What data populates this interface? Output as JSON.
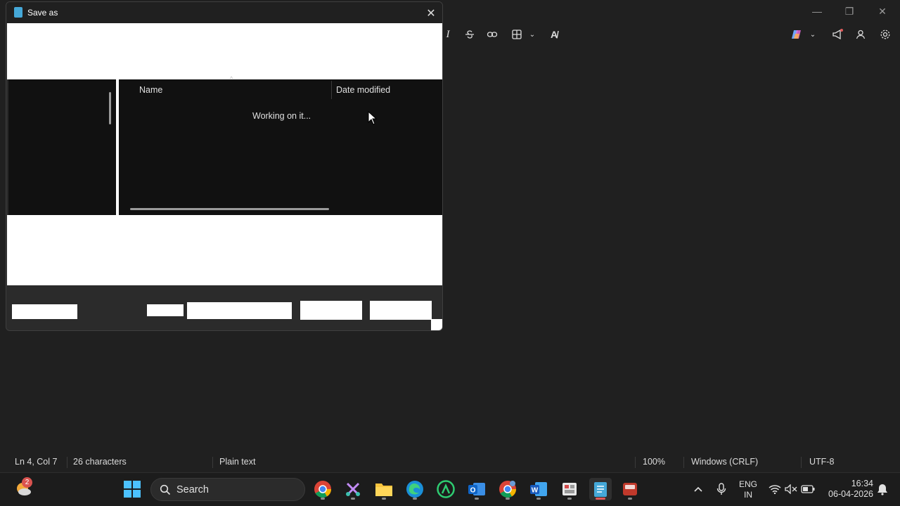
{
  "dialog": {
    "title": "Save as",
    "close_glyph": "✕",
    "columns": {
      "name": "Name",
      "date_modified": "Date modified"
    },
    "status": "Working on it..."
  },
  "notepad": {
    "toolbar_icons": [
      "italic-icon",
      "strikethrough-icon",
      "link-icon",
      "table-icon",
      "spellcheck-icon",
      "copilot-icon",
      "announcement-icon",
      "account-icon",
      "settings-icon"
    ],
    "window_controls": {
      "minimize": "—",
      "maximize": "❐",
      "close": "✕"
    },
    "status": {
      "position": "Ln 4, Col 7",
      "characters": "26 characters",
      "format": "Plain text",
      "zoom": "100%",
      "line_ending": "Windows (CRLF)",
      "encoding": "UTF-8"
    }
  },
  "taskbar": {
    "weather_badge": "2",
    "search_label": "Search",
    "apps": [
      "chrome",
      "snipping-tool",
      "file-explorer",
      "edge",
      "app-green",
      "outlook",
      "chrome-profile",
      "word",
      "app-board",
      "notepad",
      "app-red"
    ],
    "tray": {
      "language_line1": "ENG",
      "language_line2": "IN",
      "time": "16:34",
      "date": "06-04-2026"
    }
  },
  "colors": {
    "accent_notepad": "#45a8d8",
    "active_indicator": "#e05a5a",
    "background": "#202020"
  }
}
